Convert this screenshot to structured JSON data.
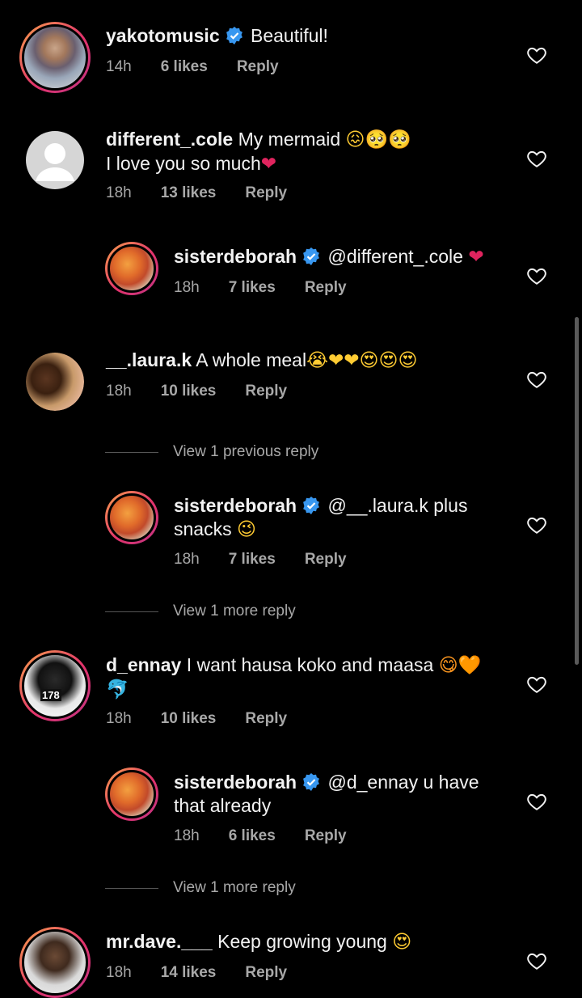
{
  "comments": [
    {
      "user": "yakotomusic",
      "verified": true,
      "text": "Beautiful!",
      "time": "14h",
      "likes": "6 likes",
      "reply": "Reply"
    },
    {
      "user": "different_.cole",
      "verified": false,
      "text": "My mermaid",
      "emoji1": "😖🥺🥺",
      "text2": "I love you so much",
      "emoji2": "❤",
      "time": "18h",
      "likes": "13 likes",
      "reply": "Reply"
    },
    {
      "user": "sisterdeborah",
      "verified": true,
      "text": "@different_.cole",
      "emoji1": "❤",
      "time": "18h",
      "likes": "7 likes",
      "reply": "Reply"
    },
    {
      "user": "__.laura.k",
      "verified": false,
      "text": "A whole meal",
      "emoji1": "😭❤❤😍😍😍",
      "time": "18h",
      "likes": "10 likes",
      "reply": "Reply"
    },
    {
      "user": "sisterdeborah",
      "verified": true,
      "text": "@__.laura.k plus",
      "text2": "snacks",
      "emoji2": "😉",
      "time": "18h",
      "likes": "7 likes",
      "reply": "Reply"
    },
    {
      "user": "d_ennay",
      "verified": false,
      "text": "I want hausa koko and maasa",
      "emoji1": "😋🧡",
      "emoji2": "🐬",
      "time": "18h",
      "likes": "10 likes",
      "reply": "Reply"
    },
    {
      "user": "sisterdeborah",
      "verified": true,
      "text": "@d_ennay u have",
      "text2": "that already",
      "time": "18h",
      "likes": "6 likes",
      "reply": "Reply"
    },
    {
      "user": "mr.dave.___",
      "verified": false,
      "text": "Keep growing young",
      "emoji1": "😍",
      "time": "18h",
      "likes": "14 likes",
      "reply": "Reply"
    }
  ],
  "view_replies": [
    "View 1 previous reply",
    "View 1 more reply",
    "View 1 more reply"
  ],
  "avatar_text": "178",
  "colors": {
    "background": "#000000",
    "text": "#f2f2f2",
    "secondary": "#a8a8a8",
    "verified": "#3897f0",
    "ring_start": "#f9a34b",
    "ring_end": "#c13584"
  }
}
